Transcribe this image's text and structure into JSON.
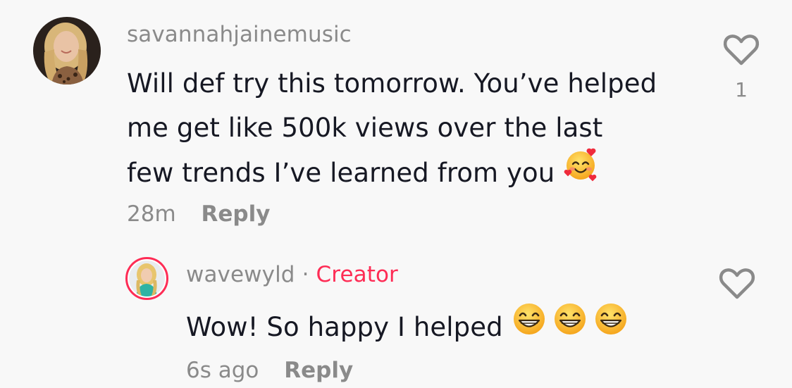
{
  "comment": {
    "username": "savannahjainemusic",
    "text_lines": [
      "Will def try this tomorrow. You’ve helped",
      "me get like 500k views over the last",
      "few trends I’ve learned from you"
    ],
    "emoji": "smiling-face-with-hearts-emoji",
    "time": "28m",
    "reply_label": "Reply",
    "like_icon": "heart-outline-icon",
    "like_count": "1"
  },
  "reply": {
    "username": "wavewyld",
    "separator": "·",
    "badge": "Creator",
    "text": "Wow! So happy I helped",
    "emojis": [
      "beaming-face-emoji",
      "beaming-face-emoji",
      "beaming-face-emoji"
    ],
    "time": "6s ago",
    "reply_label": "Reply",
    "like_icon": "heart-outline-icon"
  },
  "colors": {
    "background": "#f8f8f8",
    "text": "#161823",
    "secondary": "#8a8a8a",
    "creator_accent": "#fe2c55"
  }
}
